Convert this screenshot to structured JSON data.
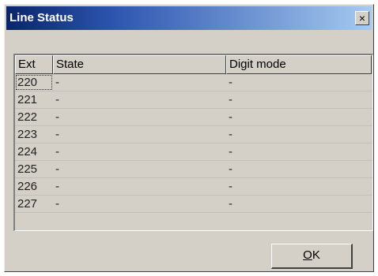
{
  "window": {
    "title": "Line Status",
    "close_glyph": "×"
  },
  "table": {
    "columns": [
      "Ext",
      "State",
      "Digit mode"
    ],
    "rows": [
      {
        "ext": "220",
        "state": "-",
        "digit_mode": "-"
      },
      {
        "ext": "221",
        "state": "-",
        "digit_mode": "-"
      },
      {
        "ext": "222",
        "state": "-",
        "digit_mode": "-"
      },
      {
        "ext": "223",
        "state": "-",
        "digit_mode": "-"
      },
      {
        "ext": "224",
        "state": "-",
        "digit_mode": "-"
      },
      {
        "ext": "225",
        "state": "-",
        "digit_mode": "-"
      },
      {
        "ext": "226",
        "state": "-",
        "digit_mode": "-"
      },
      {
        "ext": "227",
        "state": "-",
        "digit_mode": "-"
      }
    ]
  },
  "buttons": {
    "ok_label_underlined": "O",
    "ok_label_rest": "K"
  },
  "colors": {
    "title_gradient_start": "#0a246a",
    "title_gradient_end": "#a6caf0",
    "face": "#d4d0c8"
  }
}
